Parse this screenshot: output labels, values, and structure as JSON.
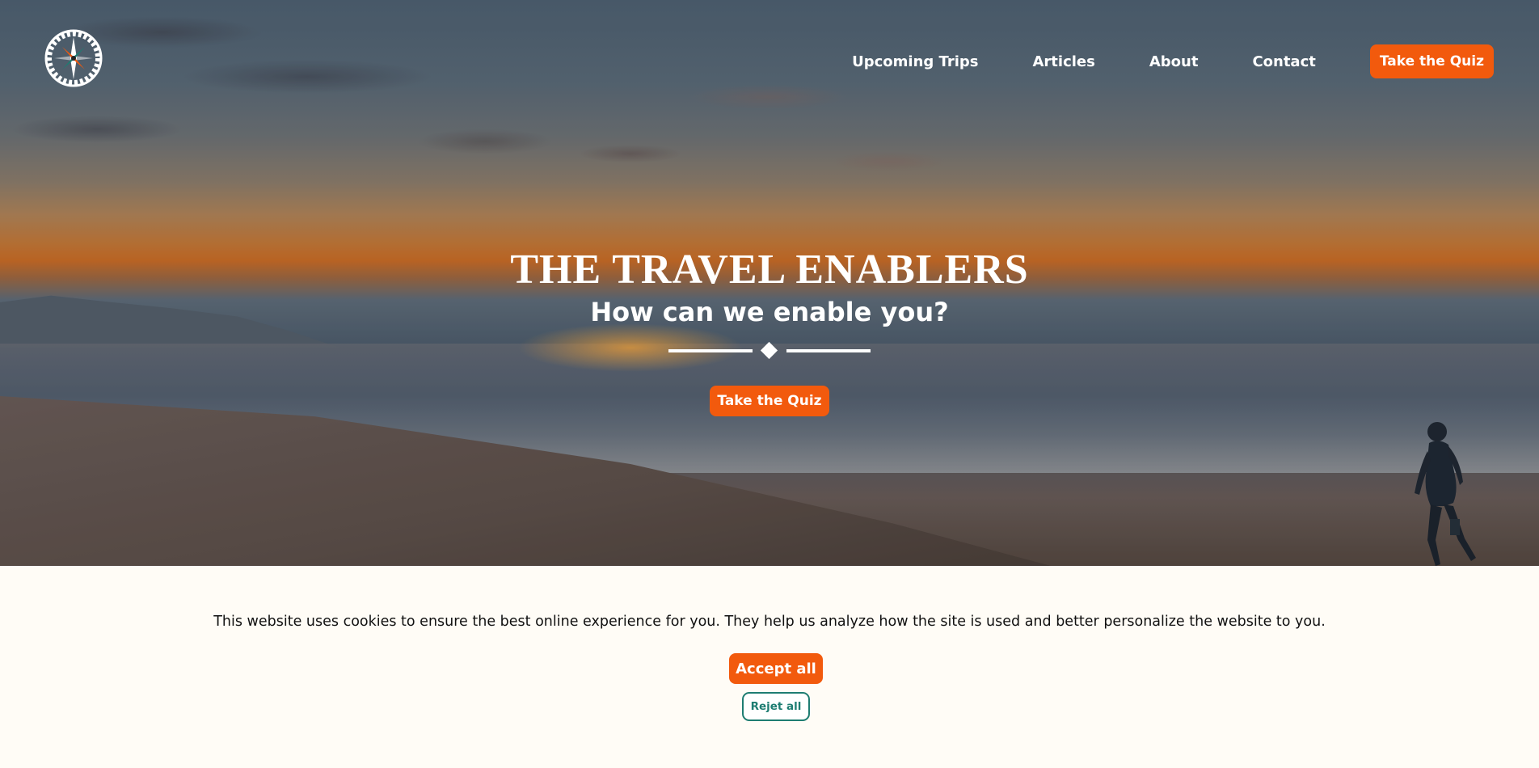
{
  "colors": {
    "accent_orange": "#f25a0d",
    "reject_teal": "#1e7d72",
    "banner_background": "#fffcf6"
  },
  "logo": {
    "icon": "compass-icon"
  },
  "nav": {
    "links": [
      "Upcoming Trips",
      "Articles",
      "About",
      "Contact"
    ],
    "cta_label": "Take the Quiz"
  },
  "hero": {
    "title": "THE TRAVEL ENABLERS",
    "subtitle": "How can we enable you?",
    "cta_label": "Take the Quiz"
  },
  "cookie_banner": {
    "message": "This website uses cookies to ensure the best online experience for you. They help us analyze how the site is used and better personalize the website to you.",
    "accept_label": "Accept all",
    "reject_label": "Rejet all"
  }
}
